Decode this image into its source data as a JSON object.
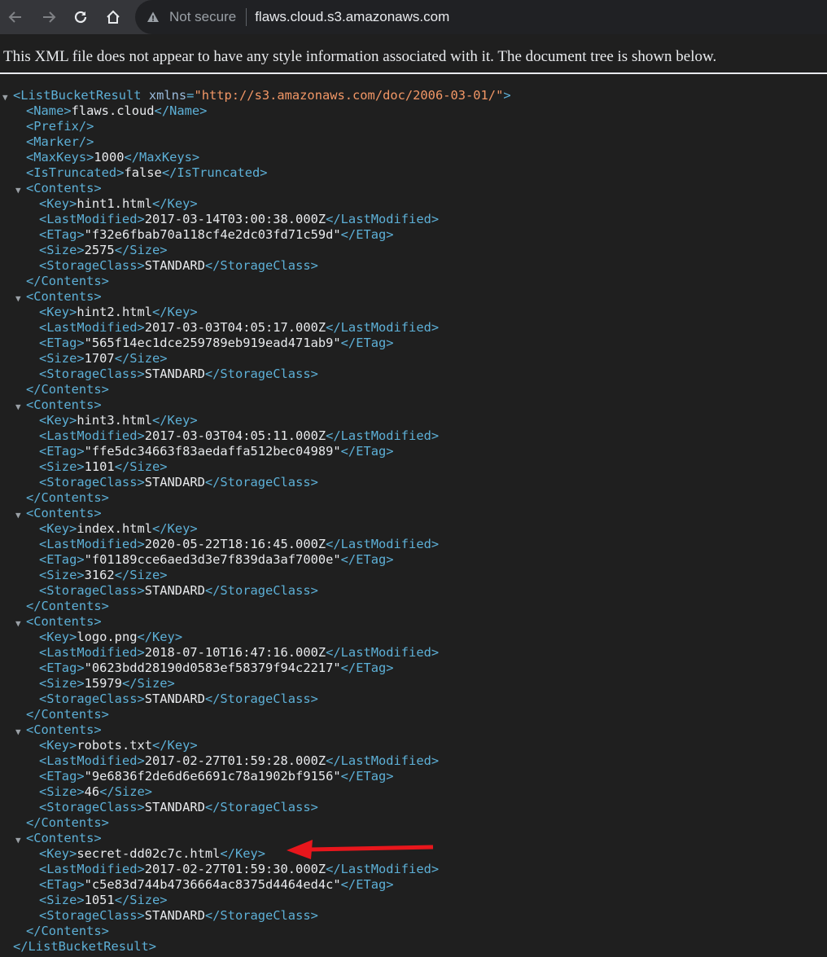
{
  "browser": {
    "security_label": "Not secure",
    "url": "flaws.cloud.s3.amazonaws.com"
  },
  "xml_notice": "This XML file does not appear to have any style information associated with it. The document tree is shown below.",
  "root": {
    "open": "<ListBucketResult",
    "attr_name": "xmlns",
    "attr_value": "\"http://s3.amazonaws.com/doc/2006-03-01/\"",
    "open_end": ">",
    "close": "</ListBucketResult>"
  },
  "header_fields": [
    {
      "open": "<Name>",
      "value": "flaws.cloud",
      "close": "</Name>"
    },
    {
      "open": "<Prefix/>",
      "value": "",
      "close": ""
    },
    {
      "open": "<Marker/>",
      "value": "",
      "close": ""
    },
    {
      "open": "<MaxKeys>",
      "value": "1000",
      "close": "</MaxKeys>"
    },
    {
      "open": "<IsTruncated>",
      "value": "false",
      "close": "</IsTruncated>"
    }
  ],
  "contents_open": "<Contents>",
  "contents_close": "</Contents>",
  "tags": {
    "key_open": "<Key>",
    "key_close": "</Key>",
    "lm_open": "<LastModified>",
    "lm_close": "</LastModified>",
    "etag_open": "<ETag>",
    "etag_close": "</ETag>",
    "size_open": "<Size>",
    "size_close": "</Size>",
    "sc_open": "<StorageClass>",
    "sc_close": "</StorageClass>"
  },
  "contents": [
    {
      "key": "hint1.html",
      "last_modified": "2017-03-14T03:00:38.000Z",
      "etag": "\"f32e6fbab70a118cf4e2dc03fd71c59d\"",
      "size": "2575",
      "storage_class": "STANDARD"
    },
    {
      "key": "hint2.html",
      "last_modified": "2017-03-03T04:05:17.000Z",
      "etag": "\"565f14ec1dce259789eb919ead471ab9\"",
      "size": "1707",
      "storage_class": "STANDARD"
    },
    {
      "key": "hint3.html",
      "last_modified": "2017-03-03T04:05:11.000Z",
      "etag": "\"ffe5dc34663f83aedaffa512bec04989\"",
      "size": "1101",
      "storage_class": "STANDARD"
    },
    {
      "key": "index.html",
      "last_modified": "2020-05-22T18:16:45.000Z",
      "etag": "\"f01189cce6aed3d3e7f839da3af7000e\"",
      "size": "3162",
      "storage_class": "STANDARD"
    },
    {
      "key": "logo.png",
      "last_modified": "2018-07-10T16:47:16.000Z",
      "etag": "\"0623bdd28190d0583ef58379f94c2217\"",
      "size": "15979",
      "storage_class": "STANDARD"
    },
    {
      "key": "robots.txt",
      "last_modified": "2017-02-27T01:59:28.000Z",
      "etag": "\"9e6836f2de6d6e6691c78a1902bf9156\"",
      "size": "46",
      "storage_class": "STANDARD"
    },
    {
      "key": "secret-dd02c7c.html",
      "last_modified": "2017-02-27T01:59:30.000Z",
      "etag": "\"c5e83d744b4736664ac8375d4464ed4c\"",
      "size": "1051",
      "storage_class": "STANDARD"
    }
  ],
  "annotation": {
    "color": "#e8161c",
    "icon": "red-arrow-icon"
  }
}
